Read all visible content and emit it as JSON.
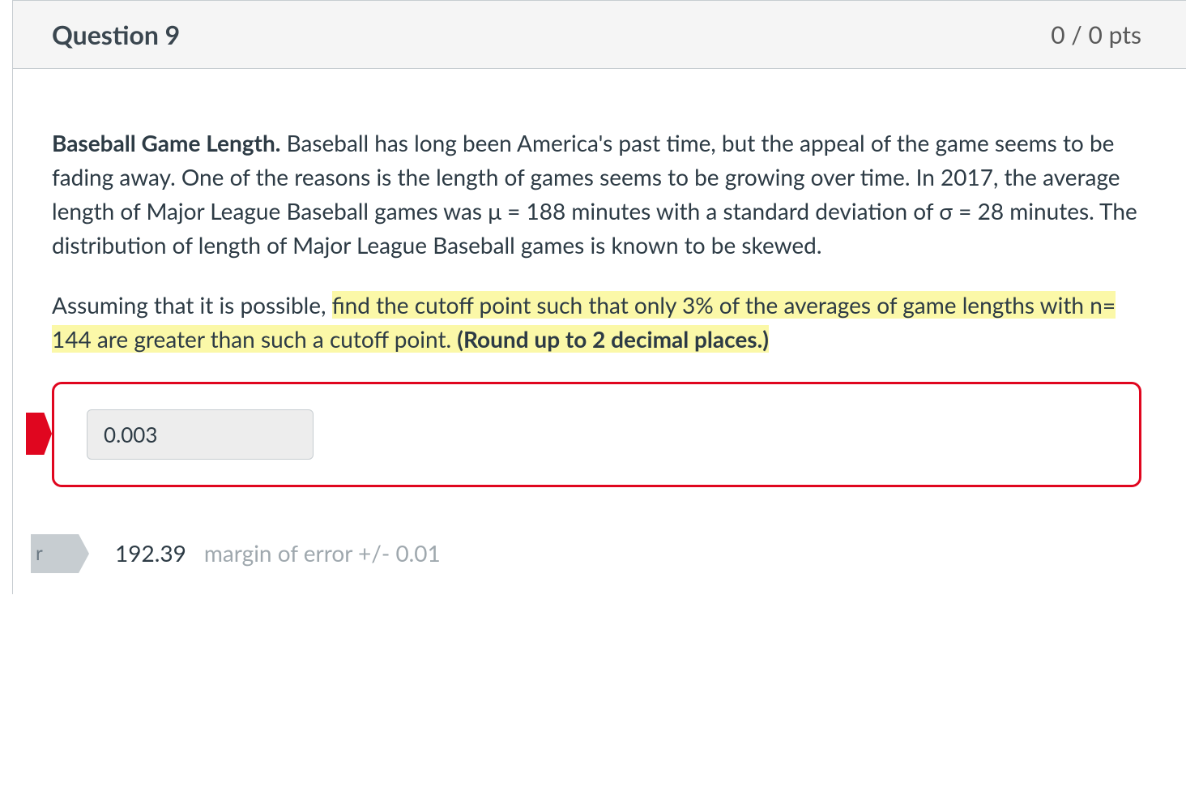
{
  "header": {
    "title": "Question 9",
    "points": "0 / 0 pts"
  },
  "body": {
    "lead_bold": "Baseball Game Length.",
    "para1_rest": " Baseball has long been America's past time, but the appeal of the game seems to be fading away. One of the reasons is the length of games seems to be growing over time. In 2017, the average length of Major League Baseball games was μ = 188 minutes with a standard deviation of σ = 28 minutes. The distribution of length of Major League Baseball games is known to be skewed.",
    "para2_pre": "Assuming that it is possible, ",
    "para2_hl1": "find the cutoff point such that only 3% of the averages of game lengths with n= 144 are greater than such a cutoff point. ",
    "para2_hl_bold": "(Round up to 2 decimal places.)"
  },
  "answer": {
    "student_value": "0.003",
    "correct_flag_text": "r",
    "correct_value": "192.39",
    "margin_error": "margin of error +/- 0.01"
  }
}
